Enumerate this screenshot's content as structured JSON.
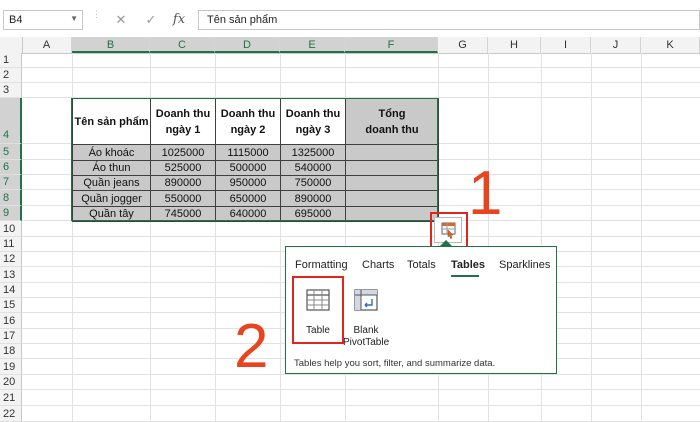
{
  "formula_bar": {
    "name_box": "B4",
    "cancel_icon": "✕",
    "enter_icon": "✓",
    "fx_label": "fx",
    "formula": "Tên sản phẩm"
  },
  "columns": [
    "A",
    "B",
    "C",
    "D",
    "E",
    "F",
    "G",
    "H",
    "I",
    "J",
    "K"
  ],
  "rows": [
    "1",
    "2",
    "3",
    "4",
    "5",
    "6",
    "7",
    "8",
    "9",
    "10",
    "11",
    "12",
    "13",
    "14",
    "15",
    "16",
    "17",
    "18",
    "19",
    "20",
    "21",
    "22"
  ],
  "table": {
    "headers": [
      "Tên sản phẩm",
      "Doanh thu\nngày 1",
      "Doanh thu\nngày 2",
      "Doanh thu\nngày 3",
      "Tổng\ndoanh thu"
    ],
    "rows": [
      [
        "Áo khoác",
        "1025000",
        "1115000",
        "1325000",
        ""
      ],
      [
        "Áo thun",
        "525000",
        "500000",
        "540000",
        ""
      ],
      [
        "Quần jeans",
        "890000",
        "950000",
        "750000",
        ""
      ],
      [
        "Quần jogger",
        "550000",
        "650000",
        "890000",
        ""
      ],
      [
        "Quần tây",
        "745000",
        "640000",
        "695000",
        ""
      ]
    ]
  },
  "quick_analysis": {
    "icon": "quick-analysis-icon",
    "tabs": [
      "Formatting",
      "Charts",
      "Totals",
      "Tables",
      "Sparklines"
    ],
    "active_tab": "Tables",
    "tiles": [
      {
        "label": "Table",
        "icon": "table-icon"
      },
      {
        "label": "Blank PivotTable",
        "icon": "pivottable-icon"
      }
    ],
    "help_text": "Tables help you sort, filter, and summarize data."
  },
  "annotations": {
    "step1": "1",
    "step2": "2",
    "color": "#e8441f"
  }
}
